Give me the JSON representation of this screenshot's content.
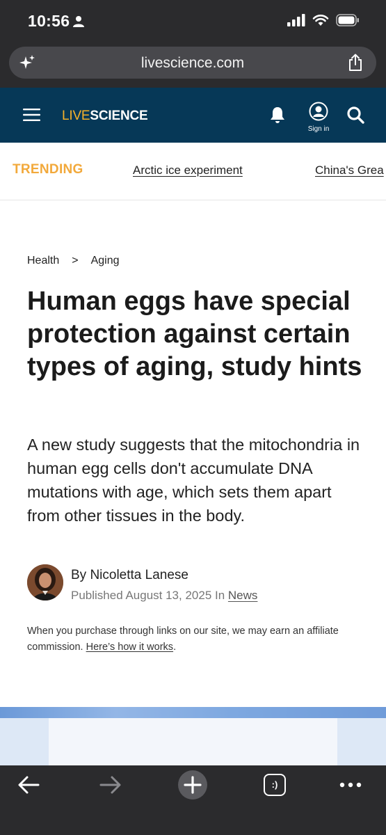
{
  "status_bar": {
    "time": "10:56"
  },
  "browser": {
    "url": "livescience.com"
  },
  "site": {
    "logo_live": "LIVE",
    "logo_science": "SCIENCE",
    "signin_label": "Sign in"
  },
  "trending": {
    "label": "TRENDING",
    "items": [
      "Arctic ice experiment",
      "China's Grea"
    ]
  },
  "article": {
    "breadcrumb": [
      "Health",
      ">",
      "Aging"
    ],
    "title": "Human eggs have special protection against certain types of aging, study hints",
    "subtitle": "A new study suggests that the mitochondria in human egg cells don't accumulate DNA mutations with age, which sets them apart from other tissues in the body.",
    "byline": "By Nicoletta Lanese",
    "published_prefix": "Published August 13, 2025 In ",
    "category_link": "News",
    "affiliate_text": "When you purchase through links on our site, we may earn an affiliate commission. ",
    "affiliate_link": "Here’s how it works",
    "affiliate_end": "."
  },
  "toolbar": {
    "tabs_glyph": ":)"
  },
  "colors": {
    "header_bg": "#063857",
    "logo_live": "#f6b12a",
    "trending_accent": "#f2a93b",
    "chrome_bg": "#2b2b2d"
  },
  "icons": [
    "person-icon",
    "signal-icon",
    "wifi-icon",
    "battery-icon",
    "sparkle-icon",
    "share-icon",
    "menu-icon",
    "bell-icon",
    "account-icon",
    "search-icon",
    "back-arrow-icon",
    "forward-arrow-icon",
    "plus-icon",
    "tabs-icon",
    "more-icon"
  ]
}
